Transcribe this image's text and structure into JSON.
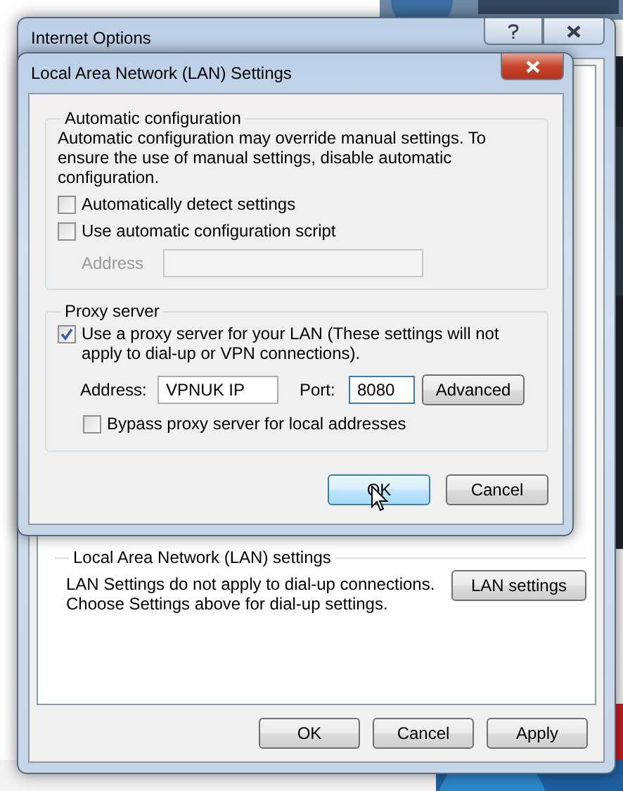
{
  "internet_options": {
    "title": "Internet Options",
    "lan_group": {
      "title": "Local Area Network (LAN) settings",
      "description": "LAN Settings do not apply to dial-up connections.\nChoose Settings above for dial-up settings.",
      "button": "LAN settings"
    },
    "buttons": [
      {
        "label": "OK"
      },
      {
        "label": "Cancel"
      },
      {
        "label": "Apply"
      }
    ]
  },
  "lan_dialog": {
    "title": "Local Area Network (LAN) Settings",
    "automatic_configuration": {
      "title": "Automatic configuration",
      "description": "Automatic configuration may override manual settings.  To ensure the use of manual settings, disable automatic configuration.",
      "options": [
        {
          "label": "Automatically detect settings",
          "checked": false
        },
        {
          "label": "Use automatic configuration script",
          "checked": false
        }
      ],
      "address": {
        "label": "Address",
        "disabled": true
      }
    },
    "proxy_server": {
      "title": "Proxy server",
      "use_proxy": {
        "label": "Use a proxy server for your LAN (These settings will not apply to dial-up or VPN connections).",
        "checked": true
      },
      "address": {
        "label": "Address:",
        "value": "VPNUK IP"
      },
      "port": {
        "label": "Port:",
        "value": "8080"
      },
      "advanced_button": "Advanced",
      "bypass": {
        "label": "Bypass proxy server for local addresses",
        "checked": false
      }
    },
    "buttons": [
      {
        "label": "OK",
        "hovered": true
      },
      {
        "label": "Cancel",
        "hovered": false
      }
    ]
  }
}
